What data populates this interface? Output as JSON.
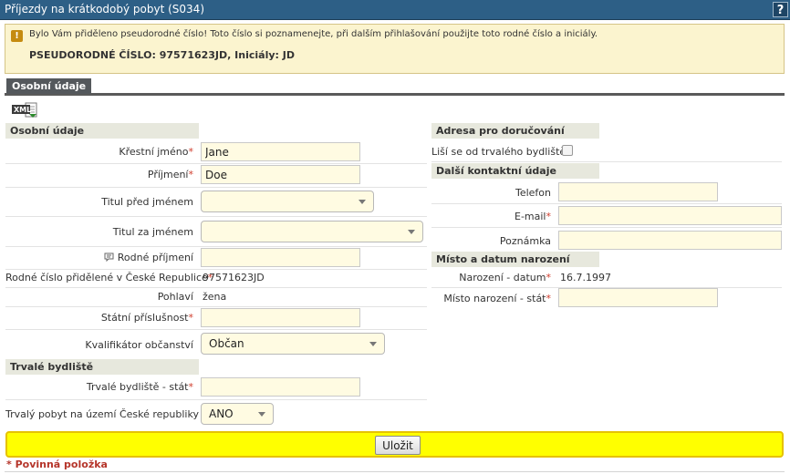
{
  "window": {
    "title": "Příjezdy na krátkodobý pobyt (S034)",
    "help_label": "?"
  },
  "notice": {
    "icon": "exclamation-icon",
    "message": "Bylo Vám přiděleno pseudorodné číslo! Toto číslo si poznamenejte, při dalším přihlašování použijte toto rodné číslo a iniciály.",
    "pseudo_line": "PSEUDORODNÉ ČÍSLO: 97571623JD, Iniciály: JD"
  },
  "tabs": [
    {
      "label": "Osobní údaje",
      "active": true
    }
  ],
  "export_icon": "xml-icon",
  "left": {
    "personal_header": "Osobní údaje",
    "first_name": {
      "label": "Křestní jméno",
      "value": "Jane",
      "required": true
    },
    "last_name": {
      "label": "Příjmení",
      "value": "Doe",
      "required": true
    },
    "title_before": {
      "label": "Titul před jménem",
      "value": ""
    },
    "title_after": {
      "label": "Titul za jménem",
      "value": ""
    },
    "birth_surname": {
      "label": "Rodné příjmení",
      "value": "",
      "icon": "speech-bubble-icon"
    },
    "birth_number": {
      "label": "Rodné číslo přidělené v České Republice",
      "value": "97571623JD",
      "required": true
    },
    "gender": {
      "label": "Pohlaví",
      "value": "žena"
    },
    "nationality": {
      "label": "Státní příslušnost",
      "value": "",
      "required": true
    },
    "citizenship_qualifier": {
      "label": "Kvalifikátor občanství",
      "value": "Občan"
    },
    "residence_header": "Trvalé bydliště",
    "residence_country": {
      "label": "Trvalé bydliště - stát",
      "value": "",
      "required": true
    },
    "residence_cz": {
      "label": "Trvalý pobyt na území České republiky",
      "value": "ANO"
    }
  },
  "right": {
    "delivery_header": "Adresa pro doručování",
    "differs": {
      "label": "Liší se od trvalého bydliště",
      "checked": false
    },
    "contact_header": "Další kontaktní údaje",
    "phone": {
      "label": "Telefon",
      "value": ""
    },
    "email": {
      "label": "E-mail",
      "value": "",
      "required": true
    },
    "note": {
      "label": "Poznámka",
      "value": ""
    },
    "birth_header": "Místo a datum narození",
    "birth_date": {
      "label": "Narození - datum",
      "value": "16.7.1997",
      "required": true
    },
    "birth_place": {
      "label": "Místo narození - stát",
      "value": "",
      "required": true
    }
  },
  "save_label": "Uložit",
  "required_legend": "* Povinná položka",
  "required_mark": "*"
}
